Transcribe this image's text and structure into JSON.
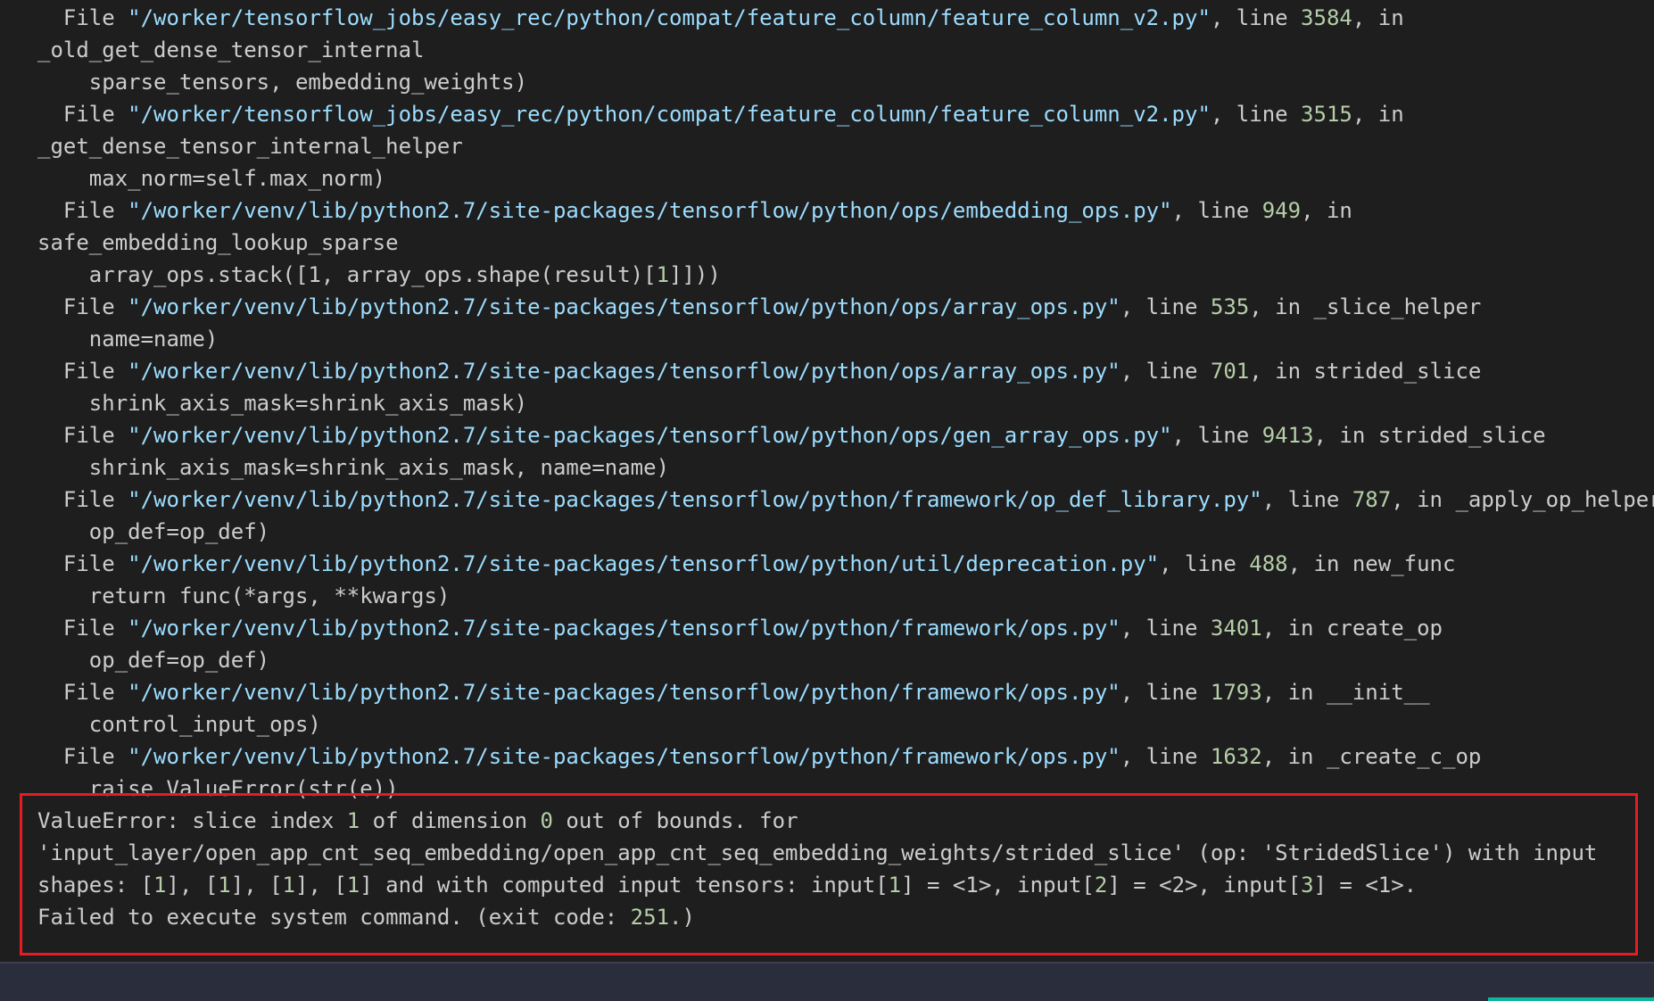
{
  "traceback": [
    {
      "segments": [
        {
          "t": "  File "
        },
        {
          "t": "\"/worker/tensorflow_jobs/easy_rec/python/compat/feature_column/feature_column_v2.py\"",
          "c": "p"
        },
        {
          "t": ", line "
        },
        {
          "t": "3584",
          "c": "n"
        },
        {
          "t": ", in"
        }
      ]
    },
    {
      "segments": [
        {
          "t": "_old_get_dense_tensor_internal"
        }
      ]
    },
    {
      "segments": [
        {
          "t": "    sparse_tensors, embedding_weights)"
        }
      ]
    },
    {
      "segments": [
        {
          "t": "  File "
        },
        {
          "t": "\"/worker/tensorflow_jobs/easy_rec/python/compat/feature_column/feature_column_v2.py\"",
          "c": "p"
        },
        {
          "t": ", line "
        },
        {
          "t": "3515",
          "c": "n"
        },
        {
          "t": ", in"
        }
      ]
    },
    {
      "segments": [
        {
          "t": "_get_dense_tensor_internal_helper"
        }
      ]
    },
    {
      "segments": [
        {
          "t": "    max_norm=self.max_norm)"
        }
      ]
    },
    {
      "segments": [
        {
          "t": "  File "
        },
        {
          "t": "\"/worker/venv/lib/python2.7/site-packages/tensorflow/python/ops/embedding_ops.py\"",
          "c": "p"
        },
        {
          "t": ", line "
        },
        {
          "t": "949",
          "c": "n"
        },
        {
          "t": ", in"
        }
      ]
    },
    {
      "segments": [
        {
          "t": "safe_embedding_lookup_sparse"
        }
      ]
    },
    {
      "segments": [
        {
          "t": "    array_ops.stack([1, array_ops.shape(result)["
        },
        {
          "t": "1",
          "c": "n"
        },
        {
          "t": "]]))"
        }
      ]
    },
    {
      "segments": [
        {
          "t": "  File "
        },
        {
          "t": "\"/worker/venv/lib/python2.7/site-packages/tensorflow/python/ops/array_ops.py\"",
          "c": "p"
        },
        {
          "t": ", line "
        },
        {
          "t": "535",
          "c": "n"
        },
        {
          "t": ", in _slice_helper"
        }
      ]
    },
    {
      "segments": [
        {
          "t": "    name=name)"
        }
      ]
    },
    {
      "segments": [
        {
          "t": "  File "
        },
        {
          "t": "\"/worker/venv/lib/python2.7/site-packages/tensorflow/python/ops/array_ops.py\"",
          "c": "p"
        },
        {
          "t": ", line "
        },
        {
          "t": "701",
          "c": "n"
        },
        {
          "t": ", in strided_slice"
        }
      ]
    },
    {
      "segments": [
        {
          "t": "    shrink_axis_mask=shrink_axis_mask)"
        }
      ]
    },
    {
      "segments": [
        {
          "t": "  File "
        },
        {
          "t": "\"/worker/venv/lib/python2.7/site-packages/tensorflow/python/ops/gen_array_ops.py\"",
          "c": "p"
        },
        {
          "t": ", line "
        },
        {
          "t": "9413",
          "c": "n"
        },
        {
          "t": ", in strided_slice"
        }
      ]
    },
    {
      "segments": [
        {
          "t": "    shrink_axis_mask=shrink_axis_mask, name=name)"
        }
      ]
    },
    {
      "segments": [
        {
          "t": "  File "
        },
        {
          "t": "\"/worker/venv/lib/python2.7/site-packages/tensorflow/python/framework/op_def_library.py\"",
          "c": "p"
        },
        {
          "t": ", line "
        },
        {
          "t": "787",
          "c": "n"
        },
        {
          "t": ", in _apply_op_helper"
        }
      ]
    },
    {
      "segments": [
        {
          "t": "    op_def=op_def)"
        }
      ]
    },
    {
      "segments": [
        {
          "t": "  File "
        },
        {
          "t": "\"/worker/venv/lib/python2.7/site-packages/tensorflow/python/util/deprecation.py\"",
          "c": "p"
        },
        {
          "t": ", line "
        },
        {
          "t": "488",
          "c": "n"
        },
        {
          "t": ", in new_func"
        }
      ]
    },
    {
      "segments": [
        {
          "t": "    return func(*args, **kwargs)"
        }
      ]
    },
    {
      "segments": [
        {
          "t": "  File "
        },
        {
          "t": "\"/worker/venv/lib/python2.7/site-packages/tensorflow/python/framework/ops.py\"",
          "c": "p"
        },
        {
          "t": ", line "
        },
        {
          "t": "3401",
          "c": "n"
        },
        {
          "t": ", in create_op"
        }
      ]
    },
    {
      "segments": [
        {
          "t": "    op_def=op_def)"
        }
      ]
    },
    {
      "segments": [
        {
          "t": "  File "
        },
        {
          "t": "\"/worker/venv/lib/python2.7/site-packages/tensorflow/python/framework/ops.py\"",
          "c": "p"
        },
        {
          "t": ", line "
        },
        {
          "t": "1793",
          "c": "n"
        },
        {
          "t": ", in __init__"
        }
      ]
    },
    {
      "segments": [
        {
          "t": "    control_input_ops)"
        }
      ]
    },
    {
      "segments": [
        {
          "t": "  File "
        },
        {
          "t": "\"/worker/venv/lib/python2.7/site-packages/tensorflow/python/framework/ops.py\"",
          "c": "p"
        },
        {
          "t": ", line "
        },
        {
          "t": "1632",
          "c": "n"
        },
        {
          "t": ", in _create_c_op"
        }
      ]
    },
    {
      "segments": [
        {
          "t": "    raise ValueError(str(e))"
        }
      ]
    }
  ],
  "error": [
    {
      "segments": [
        {
          "t": "ValueError: slice index "
        },
        {
          "t": "1",
          "c": "n"
        },
        {
          "t": " of dimension "
        },
        {
          "t": "0",
          "c": "n"
        },
        {
          "t": " out of bounds. for"
        }
      ]
    },
    {
      "segments": [
        {
          "t": "'input_layer/open_app_cnt_seq_embedding/open_app_cnt_seq_embedding_weights/strided_slice' (op: 'StridedSlice') with input"
        }
      ]
    },
    {
      "segments": [
        {
          "t": "shapes: ["
        },
        {
          "t": "1",
          "c": "n"
        },
        {
          "t": "], ["
        },
        {
          "t": "1",
          "c": "n"
        },
        {
          "t": "], ["
        },
        {
          "t": "1",
          "c": "n"
        },
        {
          "t": "], ["
        },
        {
          "t": "1",
          "c": "n"
        },
        {
          "t": "] and with computed input tensors: input["
        },
        {
          "t": "1",
          "c": "n"
        },
        {
          "t": "] = <1>, input["
        },
        {
          "t": "2",
          "c": "n"
        },
        {
          "t": "] = <2>, input["
        },
        {
          "t": "3",
          "c": "n"
        },
        {
          "t": "] = <1>."
        }
      ]
    },
    {
      "segments": [
        {
          "t": "Failed to execute system command. (exit code: "
        },
        {
          "t": "251.",
          "c": "n"
        },
        {
          "t": ")"
        }
      ]
    }
  ],
  "colors": {
    "background": "#1e1e1e",
    "text": "#cccccc",
    "path": "#9cdcfe",
    "number": "#b5cea8",
    "highlight_border": "#e51c23",
    "status_bar": "#2a2d3c",
    "status_accent": "#0fb59c"
  }
}
